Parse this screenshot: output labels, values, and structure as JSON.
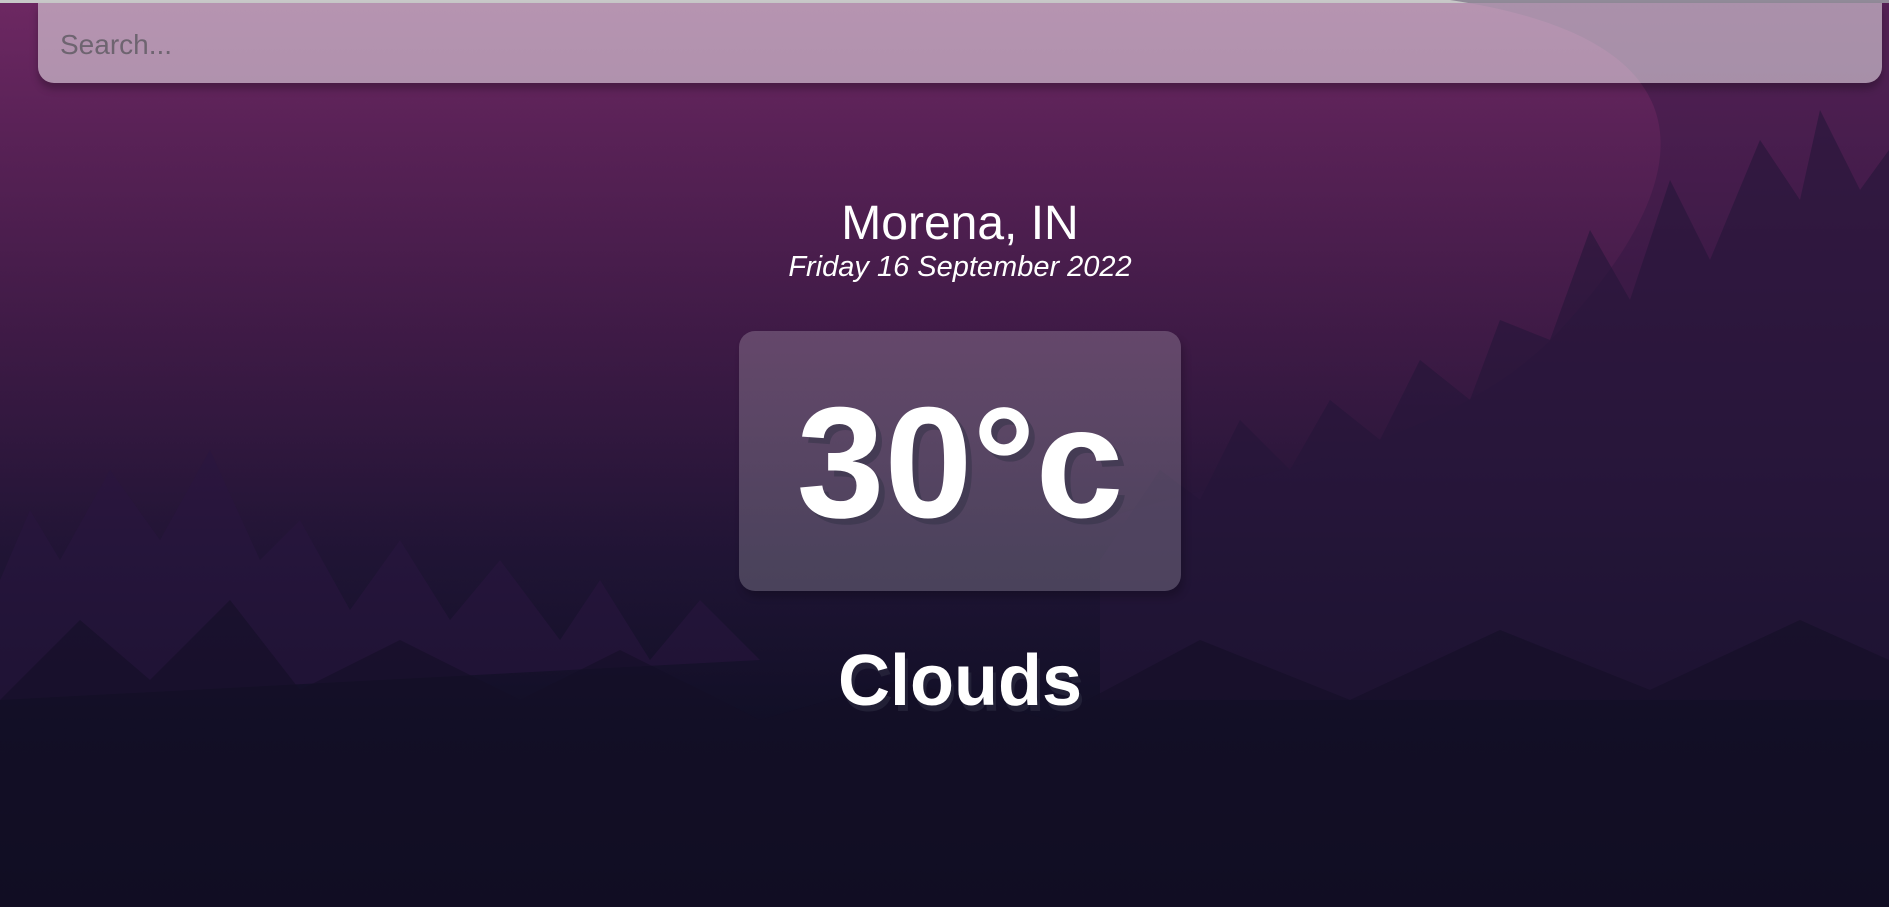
{
  "search": {
    "placeholder": "Search...",
    "value": ""
  },
  "location": {
    "city_country": "Morena, IN",
    "date": "Friday 16 September 2022"
  },
  "weather": {
    "temperature": "30°c",
    "condition": "Clouds"
  },
  "colors": {
    "background_top": "#6d2862",
    "background_bottom": "#0d0c1f",
    "text": "#ffffff"
  }
}
